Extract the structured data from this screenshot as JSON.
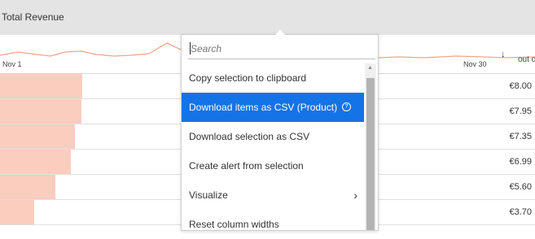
{
  "header": {
    "title": "Total Revenue"
  },
  "sparkline": {
    "start_label": "Nov 1",
    "end_label": "Nov 30"
  },
  "column": {
    "header": "out of",
    "sort_icon": "arrow-down-icon"
  },
  "rows": [
    {
      "value": "€8.00"
    },
    {
      "value": "€7.95"
    },
    {
      "value": "€7.35"
    },
    {
      "value": "€6.99"
    },
    {
      "value": "€5.60"
    },
    {
      "value": "€3.70"
    }
  ],
  "menu": {
    "search_placeholder": "Search",
    "items": [
      {
        "label": "Copy selection to clipboard"
      },
      {
        "label": "Download items as CSV (Product)",
        "selected": true,
        "help": "?"
      },
      {
        "label": "Download selection as CSV"
      },
      {
        "label": "Create alert from selection"
      },
      {
        "label": "Visualize",
        "submenu_icon": "›"
      },
      {
        "label": "Reset column widths"
      }
    ]
  },
  "colors": {
    "accent": "#1473e6",
    "bar": "#fbcdbf",
    "sparkline": "#f0a58a",
    "header_bg": "#e4e4e4"
  }
}
